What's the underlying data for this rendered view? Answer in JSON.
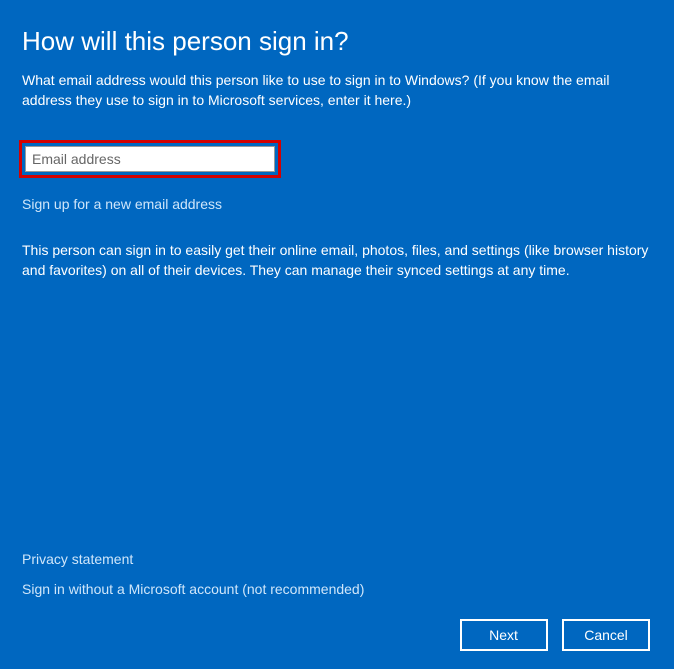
{
  "title": "How will this person sign in?",
  "subtitle": "What email address would this person like to use to sign in to Windows? (If you know the email address they use to sign in to Microsoft services, enter it here.)",
  "email": {
    "placeholder": "Email address",
    "value": ""
  },
  "signup_link": "Sign up for a new email address",
  "description": "This person can sign in to easily get their online email, photos, files, and settings (like browser history and favorites) on all of their devices. They can manage their synced settings at any time.",
  "footer": {
    "privacy_link": "Privacy statement",
    "no_account_link": "Sign in without a Microsoft account (not recommended)"
  },
  "buttons": {
    "next": "Next",
    "cancel": "Cancel"
  }
}
